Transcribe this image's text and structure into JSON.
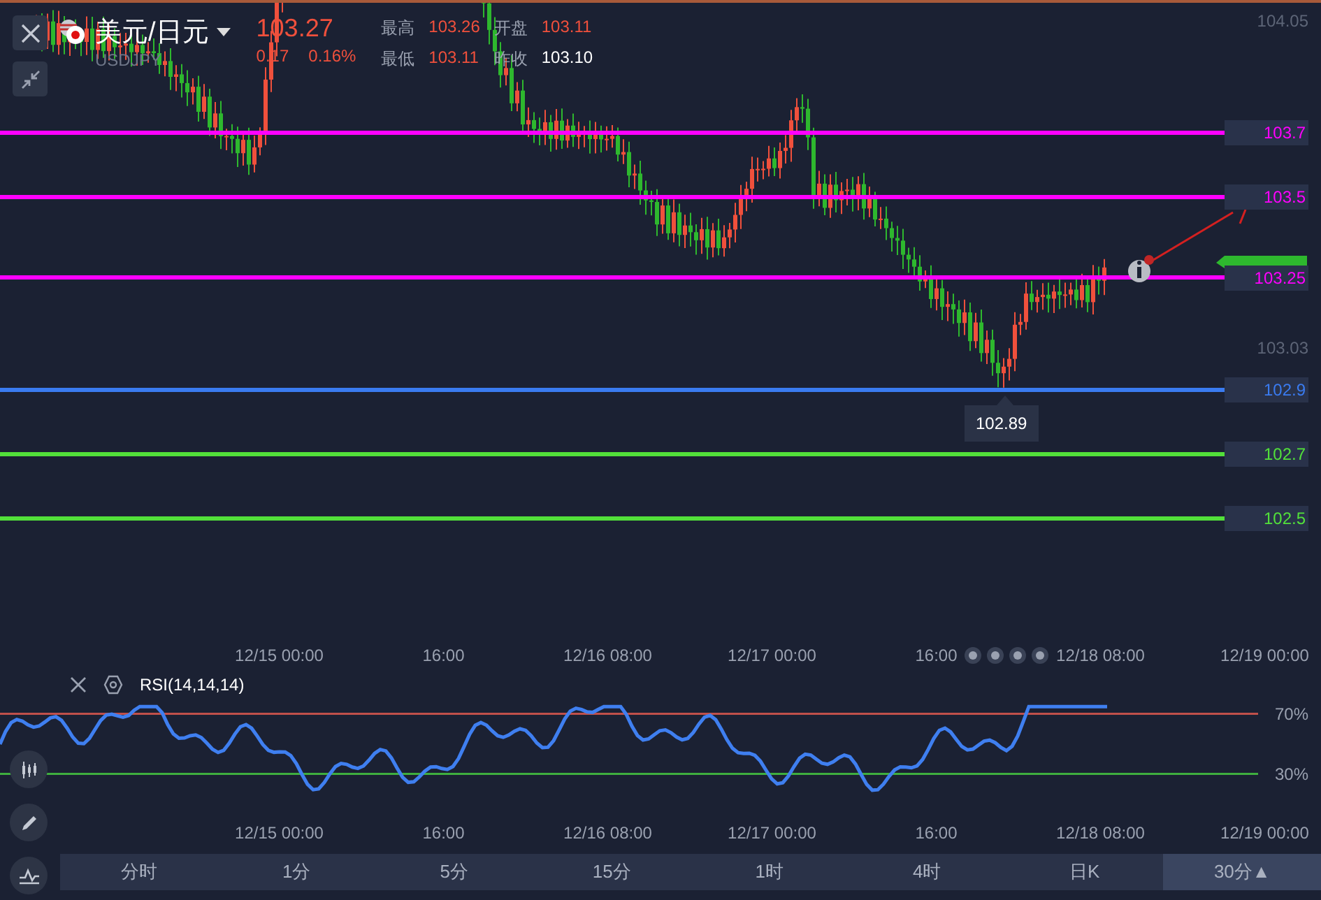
{
  "header": {
    "title": "美元/日元",
    "symbol": "USDJPY",
    "price": "103.27",
    "change": "0.17",
    "change_pct": "0.16%",
    "stats": [
      {
        "label": "最高",
        "value": "103.26",
        "color": "#f0503c"
      },
      {
        "label": "开盘",
        "value": "103.11",
        "color": "#f0503c"
      },
      {
        "label": "最低",
        "value": "103.11",
        "color": "#f0503c"
      },
      {
        "label": "昨收",
        "value": "103.10",
        "color": "#ffffff"
      }
    ]
  },
  "price_axis": [
    "104.05",
    "103.03"
  ],
  "levels": [
    {
      "value": "103.7",
      "color": "#ff00ff"
    },
    {
      "value": "103.5",
      "color": "#ff00ff"
    },
    {
      "value": "103.25",
      "color": "#ff00ff"
    },
    {
      "value": "102.9",
      "color": "#3a7bf0"
    },
    {
      "value": "102.7",
      "color": "#52e03a"
    },
    {
      "value": "102.5",
      "color": "#52e03a"
    }
  ],
  "low_marker": "102.89",
  "main_time_axis": [
    "12/15 00:00",
    "16:00",
    "12/16 08:00",
    "12/17 00:00",
    "16:00",
    "12/18 08:00",
    "12/19 00:00"
  ],
  "rsi": {
    "title": "RSI(14,14,14)",
    "upper": "70%",
    "lower": "30%"
  },
  "rsi_time_axis": [
    "12/15 00:00",
    "16:00",
    "12/16 08:00",
    "12/17 00:00",
    "16:00",
    "12/18 08:00",
    "12/19 00:00"
  ],
  "periods": [
    {
      "label": "分时",
      "selected": false
    },
    {
      "label": "1分",
      "selected": false
    },
    {
      "label": "5分",
      "selected": false
    },
    {
      "label": "15分",
      "selected": false
    },
    {
      "label": "1时",
      "selected": false
    },
    {
      "label": "4时",
      "selected": false
    },
    {
      "label": "日K",
      "selected": false
    },
    {
      "label": "30分▲",
      "selected": true
    }
  ]
}
